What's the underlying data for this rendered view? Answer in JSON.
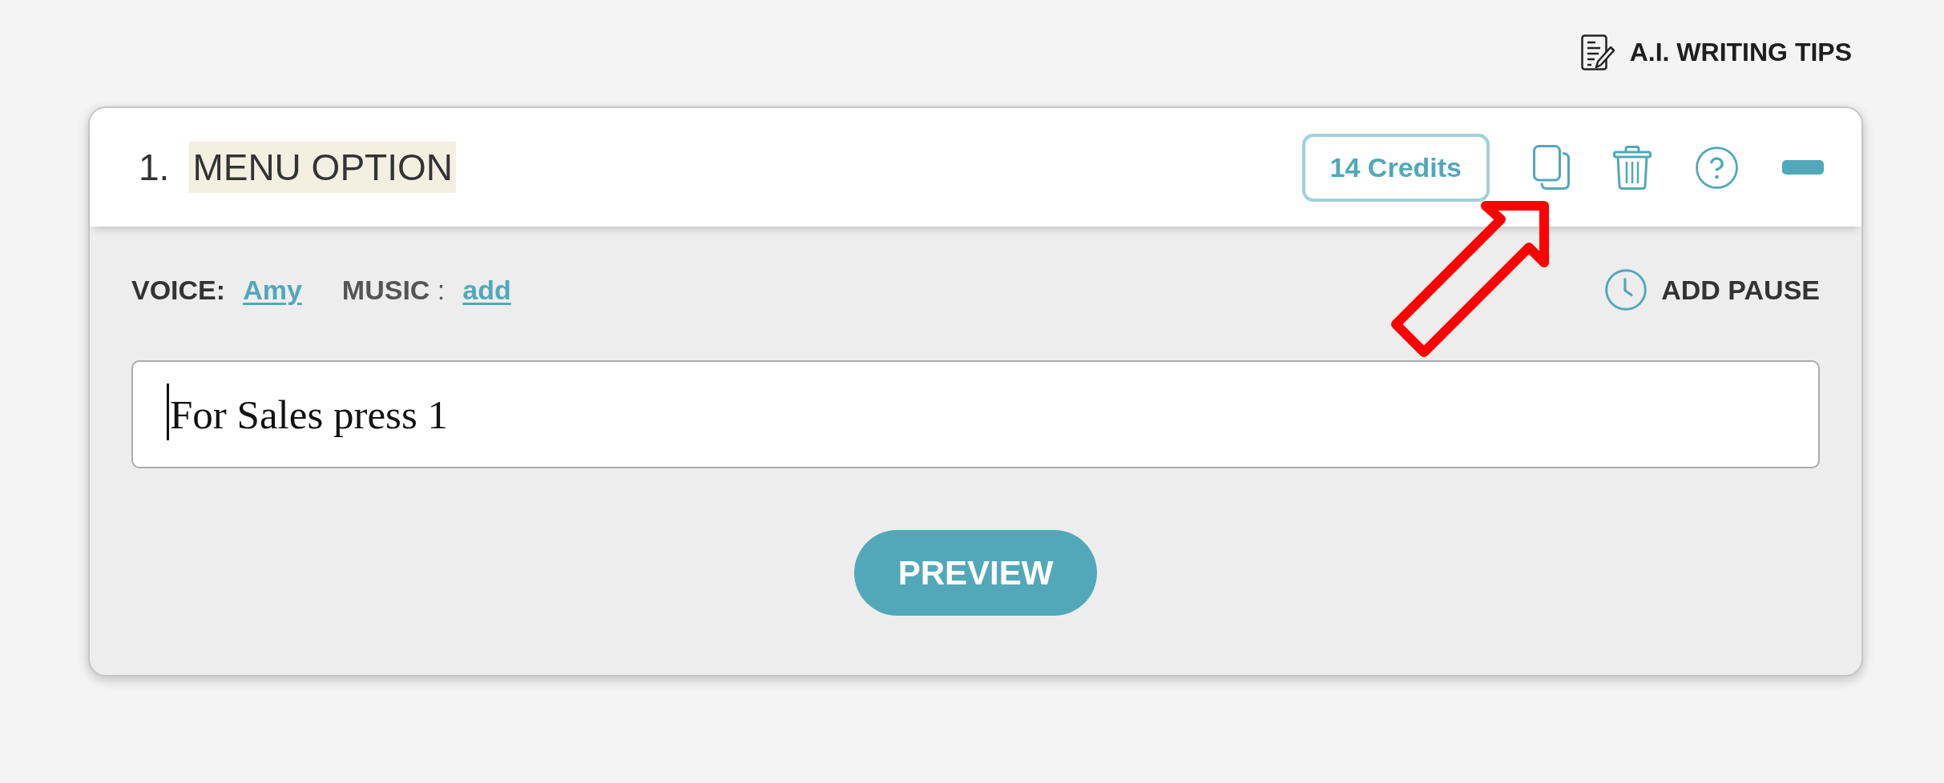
{
  "tips_link": {
    "label": "A.I. WRITING TIPS"
  },
  "card": {
    "number": "1.",
    "title": "MENU OPTION",
    "title_highlighted": true,
    "credits": "14 Credits",
    "expanded": true,
    "voice": {
      "label": "VOICE:",
      "value": "Amy"
    },
    "music": {
      "label": "**MUSIC** :",
      "value": "add"
    },
    "add_pause": "ADD PAUSE",
    "script": {
      "value": "For Sales press 1",
      "focused": true
    },
    "preview": "PREVIEW"
  }
}
